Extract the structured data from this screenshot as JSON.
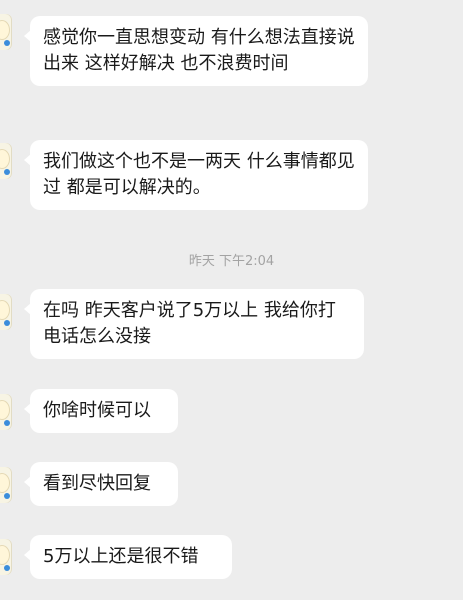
{
  "messages": [
    {
      "text": "感觉你一直思想变动 有什么想法直接说出来 这样好解决 也不浪费时间"
    },
    {
      "text": "我们做这个也不是一两天 什么事情都见过 都是可以解决的。"
    },
    {
      "text": "在吗 昨天客户说了5万以上 我给你打电话怎么没接"
    },
    {
      "text": "你啥时候可以"
    },
    {
      "text": "看到尽快回复"
    },
    {
      "text": "5万以上还是很不错"
    }
  ],
  "timestamp": "昨天 下午2:04",
  "colors": {
    "background": "#ededed",
    "bubble": "#ffffff",
    "text": "#1a1a1a",
    "timestamp": "#a3a3a3"
  },
  "icons": {
    "avatar": "user-avatar-icon"
  }
}
